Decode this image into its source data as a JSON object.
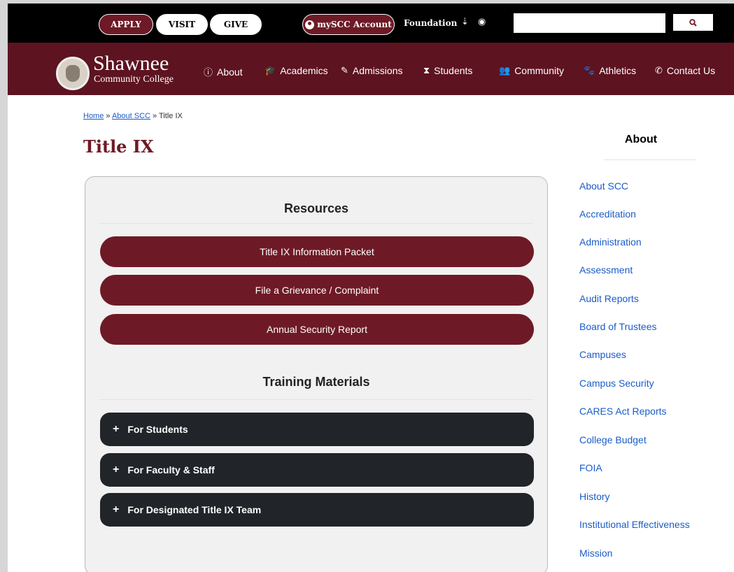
{
  "topbar": {
    "apply": "APPLY",
    "visit": "VISIT",
    "give": "GIVE",
    "myscc": "mySCC Account",
    "foundation": "Foundation",
    "search_placeholder": "",
    "search_icon": "search-icon"
  },
  "logo": {
    "name": "Shawnee",
    "sub": "Community College"
  },
  "nav": {
    "about": "About",
    "academics": "Academics",
    "admissions": "Admissions",
    "students": "Students",
    "community": "Community",
    "athletics": "Athletics",
    "contact": "Contact Us"
  },
  "breadcrumb": {
    "home": "Home",
    "sep1": " » ",
    "about": "About SCC",
    "sep2": " » ",
    "current": "Title IX"
  },
  "page": {
    "title": "Title IX"
  },
  "card": {
    "resources_heading": "Resources",
    "resource_buttons": [
      "Title IX Information Packet",
      "File a Grievance / Complaint",
      "Annual Security Report"
    ],
    "training_heading": "Training Materials",
    "training_items": [
      "For Students",
      "For Faculty & Staff",
      "For Designated Title IX Team"
    ]
  },
  "sidebar": {
    "title": "About",
    "links": [
      "About SCC",
      "Accreditation",
      "Administration",
      "Assessment",
      "Audit Reports",
      "Board of Trustees",
      "Campuses",
      "Campus Security",
      "CARES Act Reports",
      "College Budget",
      "FOIA",
      "History",
      "Institutional Effectiveness",
      "Mission"
    ]
  },
  "colors": {
    "brand_maroon": "#6e1a26",
    "nav_maroon": "#5d1320",
    "link_blue": "#1a5cc8",
    "dark_button": "#212529"
  }
}
